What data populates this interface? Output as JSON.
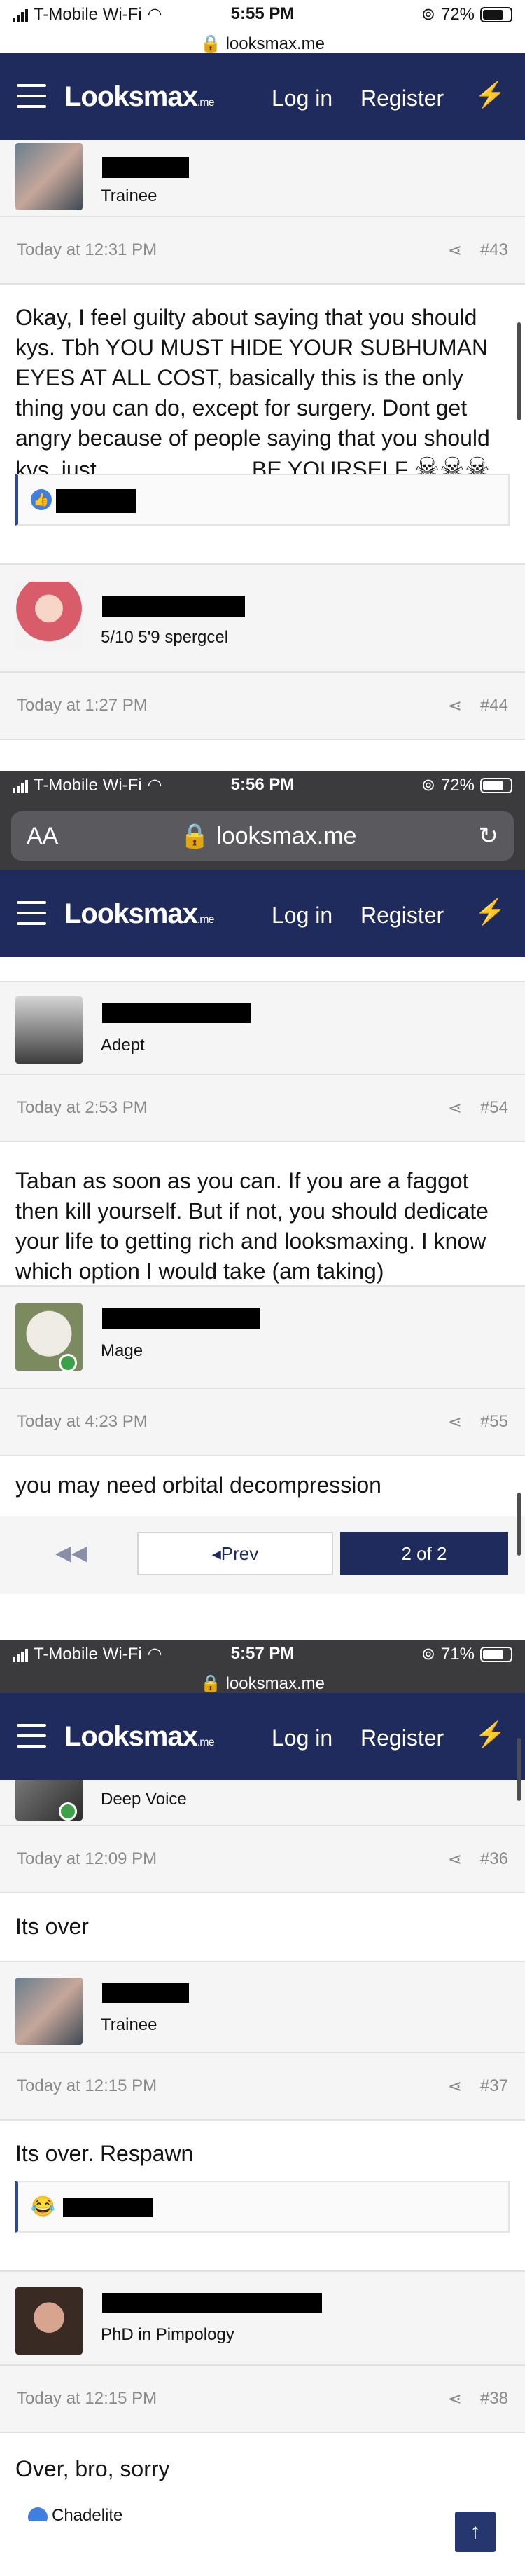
{
  "screens": [
    {
      "status": {
        "carrier": "T-Mobile Wi-Fi",
        "time": "5:55 PM",
        "battery": "72%"
      },
      "url": "looksmax.me",
      "nav": {
        "logo": "Looksmax",
        "logo_suffix": ".me",
        "login": "Log in",
        "register": "Register"
      },
      "posts": [
        {
          "user_title": "Trainee",
          "time": "Today at 12:31 PM",
          "number": "#43",
          "body": "Okay, I feel guilty about saying that you should kys. Tbh YOU MUST HIDE YOUR SUBHUMAN EYES AT ALL COST, basically this is the only thing you can do, except for surgery. Dont get angry because of people saying that you should kys, just.........................BE YOURSELF"
        },
        {
          "user_title": "5/10 5'9 spergcel",
          "time": "Today at 1:27 PM",
          "number": "#44"
        }
      ]
    },
    {
      "status": {
        "carrier": "T-Mobile Wi-Fi",
        "time": "5:56 PM",
        "battery": "72%"
      },
      "url": "looksmax.me",
      "text_size_label": "AA",
      "nav": {
        "logo": "Looksmax",
        "logo_suffix": ".me",
        "login": "Log in",
        "register": "Register"
      },
      "posts": [
        {
          "user_title": "Adept",
          "time": "Today at 2:53 PM",
          "number": "#54",
          "body": "Taban as soon as you can. If you are a faggot then kill yourself. But if not, you should dedicate your life to getting rich and looksmaxing. I know which option I would take (am taking)"
        },
        {
          "user_title": "Mage",
          "time": "Today at 4:23 PM",
          "number": "#55",
          "body": "you may need orbital decompression"
        }
      ],
      "pager": {
        "prev": "Prev",
        "current": "2 of 2"
      }
    },
    {
      "status": {
        "carrier": "T-Mobile Wi-Fi",
        "time": "5:57 PM",
        "battery": "71%"
      },
      "url": "looksmax.me",
      "nav": {
        "logo": "Looksmax",
        "logo_suffix": ".me",
        "login": "Log in",
        "register": "Register"
      },
      "top_user_title": "Deep Voice",
      "posts": [
        {
          "time": "Today at 12:09 PM",
          "number": "#36",
          "body": "Its over"
        },
        {
          "user_title": "Trainee",
          "time": "Today at 12:15 PM",
          "number": "#37",
          "body": "Its over. Respawn"
        },
        {
          "user_title": "PhD in Pimpology",
          "time": "Today at 12:15 PM",
          "number": "#38",
          "body": "Over, bro, sorry"
        }
      ],
      "bottom_partial_name": "Chadelite"
    }
  ],
  "icons": {
    "share": "share-icon",
    "like": "like-reaction-icon",
    "laugh": "laugh-reaction-icon"
  },
  "colors": {
    "nav": "#1f2b5c",
    "accent": "#2b4a9e"
  }
}
